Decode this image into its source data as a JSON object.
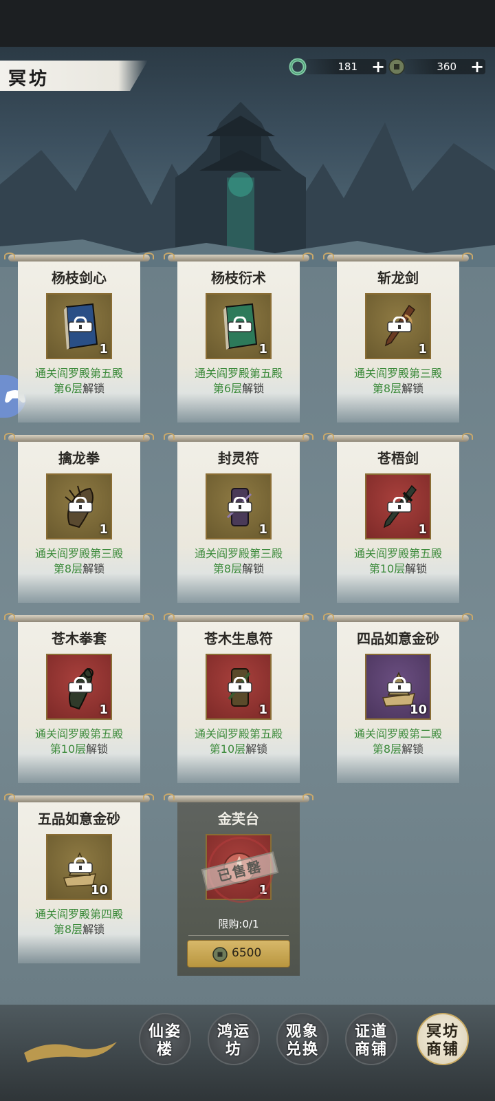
{
  "header": {
    "title": "冥坊"
  },
  "currencies": [
    {
      "name": "jade-ring-currency",
      "value": "181",
      "plus": "+"
    },
    {
      "name": "copper-coin-currency",
      "value": "360",
      "plus": "+"
    }
  ],
  "cards": [
    {
      "name": "杨枝剑心",
      "qty": "1",
      "frame": "gold",
      "art": "blue-book",
      "unlock_l1": "通关阎罗殿第五殿",
      "unlock_num": "第6层",
      "unlock_rest": "解锁"
    },
    {
      "name": "杨枝衍术",
      "qty": "1",
      "frame": "gold",
      "art": "green-book",
      "unlock_l1": "通关阎罗殿第五殿",
      "unlock_num": "第6层",
      "unlock_rest": "解锁"
    },
    {
      "name": "斩龙剑",
      "qty": "1",
      "frame": "gold",
      "art": "sword",
      "unlock_l1": "通关阎罗殿第三殿",
      "unlock_num": "第8层",
      "unlock_rest": "解锁"
    },
    {
      "name": "擒龙拳",
      "qty": "1",
      "frame": "gold",
      "art": "claw",
      "unlock_l1": "通关阎罗殿第三殿",
      "unlock_num": "第8层",
      "unlock_rest": "解锁"
    },
    {
      "name": "封灵符",
      "qty": "1",
      "frame": "gold",
      "art": "scroll",
      "unlock_l1": "通关阎罗殿第三殿",
      "unlock_num": "第8层",
      "unlock_rest": "解锁"
    },
    {
      "name": "苍梧剑",
      "qty": "1",
      "frame": "red",
      "art": "sword",
      "unlock_l1": "通关阎罗殿第五殿",
      "unlock_num": "第10层",
      "unlock_rest": "解锁"
    },
    {
      "name": "苍木拳套",
      "qty": "1",
      "frame": "red",
      "art": "claw",
      "unlock_l1": "通关阎罗殿第五殿",
      "unlock_num": "第10层",
      "unlock_rest": "解锁"
    },
    {
      "name": "苍木生息符",
      "qty": "1",
      "frame": "red",
      "art": "scroll",
      "unlock_l1": "通关阎罗殿第五殿",
      "unlock_num": "第10层",
      "unlock_rest": "解锁"
    },
    {
      "name": "四品如意金砂",
      "qty": "10",
      "frame": "purple",
      "art": "sand",
      "unlock_l1": "通关阎罗殿第二殿",
      "unlock_num": "第8层",
      "unlock_rest": "解锁"
    },
    {
      "name": "五品如意金砂",
      "qty": "10",
      "frame": "gold",
      "art": "sand",
      "unlock_l1": "通关阎罗殿第四殿",
      "unlock_num": "第8层",
      "unlock_rest": "解锁"
    }
  ],
  "sold_card": {
    "name": "金芙台",
    "qty": "1",
    "stamp": "已售罄",
    "limit": "限购:0/1",
    "price": "6500"
  },
  "bottom_nav": [
    {
      "label_l1": "仙姿",
      "label_l2": "楼",
      "active": false
    },
    {
      "label_l1": "鸿运",
      "label_l2": "坊",
      "active": false
    },
    {
      "label_l1": "观象",
      "label_l2": "兑换",
      "active": false
    },
    {
      "label_l1": "证道",
      "label_l2": "商铺",
      "active": false
    },
    {
      "label_l1": "冥坊",
      "label_l2": "商铺",
      "active": true
    }
  ],
  "colors": {
    "unlock_green": "#3b8a3a",
    "accent_gold": "#c8a960",
    "sold_red": "#b43c3c"
  }
}
